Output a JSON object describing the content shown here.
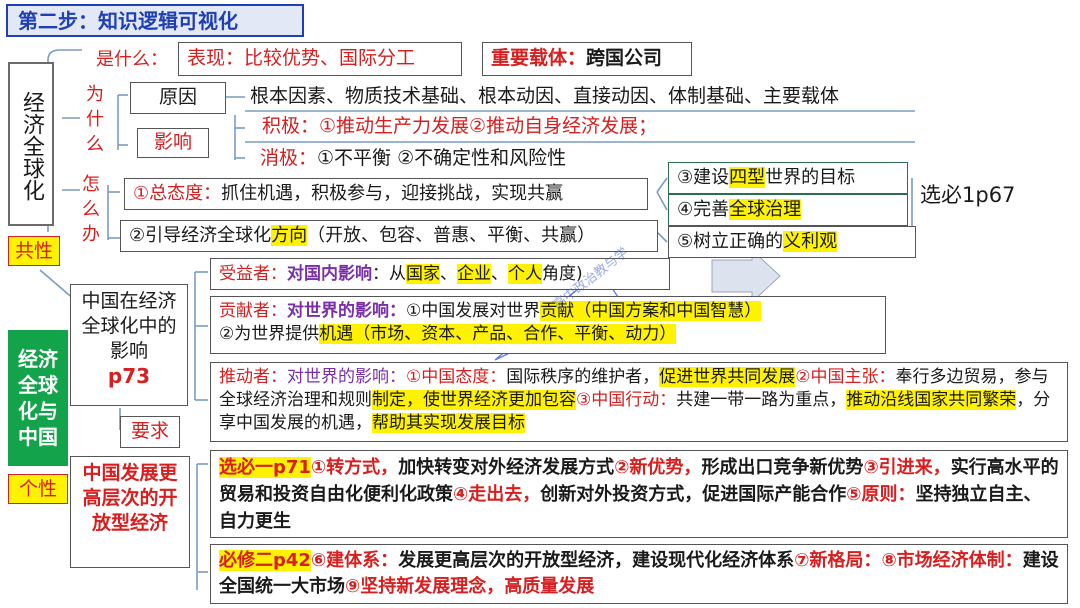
{
  "title": "第二步：知识逻辑可视化",
  "left": {
    "jjqqh": "经济全球化",
    "gongxing": "共性",
    "main_center": [
      "经济",
      "全球",
      "化与",
      "中国"
    ],
    "gexing": "个性"
  },
  "q_labels": {
    "shenme": "是什么：",
    "weishenme": [
      "为",
      "什",
      "么"
    ],
    "zenmeban": [
      "怎",
      "么",
      "办"
    ]
  },
  "shenme": {
    "biaoxian_label": "表现：",
    "biaoxian_text": "比较优势、国际分工",
    "zaiti_label": "重要载体：",
    "zaiti_text": "跨国公司"
  },
  "yuanyin": {
    "label": "原因",
    "text": "根本因素、物质技术基础、根本动因、直接动因、体制基础、主要载体"
  },
  "yingxiang": {
    "label": "影响",
    "jiji_label": "积极：",
    "jiji_text": "①推动生产力发展②推动自身经济发展；",
    "xiaoji_label": "消极：",
    "xiaoji_text": "①不平衡 ②不确定性和风险性"
  },
  "zenmeban": {
    "item1_label": "①总态度：",
    "item1_text": "抓住机遇，积极参与，迎接挑战，实现共赢",
    "item2_a": "②引导经济全球化",
    "item2_hl": "方向",
    "item2_b": "（开放、包容、普惠、平衡、共赢）"
  },
  "right_boxes": {
    "b1_a": "③建设",
    "b1_hl": "四型",
    "b1_b": "世界的目标",
    "b2_a": "④完善",
    "b2_hl": "全球治理",
    "b3_a": "⑤树立正确的",
    "b3_hl": "义利观",
    "ref": "选必1p67"
  },
  "china_influence": "中国在经济全球化中的影响",
  "china_page": "p73",
  "yaoqiu": "要求",
  "china_dev": "中国发展更高层次的开放型经济",
  "shouyi": {
    "label": "受益者：",
    "title": "对国内影响",
    "text_a": "：从",
    "hl1": "国家",
    "sep1": "、",
    "hl2": "企业",
    "sep2": "、",
    "hl3": "个人",
    "text_b": "角度)"
  },
  "gongxian": {
    "label": "贡献者：",
    "title": "对世界的影响：",
    "line1_a": "①中国发展对世界",
    "line1_hl": "贡献（中国方案和中国智慧）",
    "line2_a": "②为世界提供",
    "line2_hl": "机遇（市场、资本、产品、合作、平衡、动力）"
  },
  "tuidong": {
    "label": "推动者：",
    "title": "对世界的影响：",
    "s1": "①中国态度：",
    "t1": "国际秩序的维护者，",
    "h1": "促进世界共同发展",
    "s2": "②中国主张：",
    "t2": "奉行多边贸易，参与全球经济治理和规则",
    "h2": "制定，使世界经济更加包容",
    "s3": "③中国行动：",
    "t3": "共建一带一路为重点，",
    "h3": "推动沿线国家共同繁荣",
    "t4": "，分享中国发展的机遇，",
    "h4": "帮助其实现发展目标"
  },
  "xuanbi": {
    "ref": "选必一p71",
    "s1": "①转方式，",
    "t1": "加快转变对外经济发展方式",
    "s2": "②新优势，",
    "t2": "形成出口竞争新优势",
    "s3": "③引进来，",
    "t3": "实行高水平的贸易和投资自由化便利化政策",
    "s4": "④走出去，",
    "t4": "创新对外投资方式，促进国际产能合作",
    "s5": "⑤原则：",
    "t5": "坚持独立自主、自力更生"
  },
  "bixiu": {
    "ref": "必修二p42",
    "s6": "⑥建体系：",
    "t6": "发展更高层次的开放型经济，建设现代化经济体系",
    "s7": "⑦新格局：",
    "s8": "⑧市场经济体制：",
    "t8": "建设全国统一大市场",
    "s9": "⑨坚持新发展理念，",
    "t9": "高质量发展"
  },
  "watermark": "高中政治教与学",
  "colors": {
    "title_bg": "#e3e8f6",
    "title_border": "#1f3fb4",
    "title_text": "#1f3fb4",
    "red": "#d81e1e",
    "purple": "#7a2fa8",
    "green": "#12a34b",
    "highlight": "#fff200"
  }
}
